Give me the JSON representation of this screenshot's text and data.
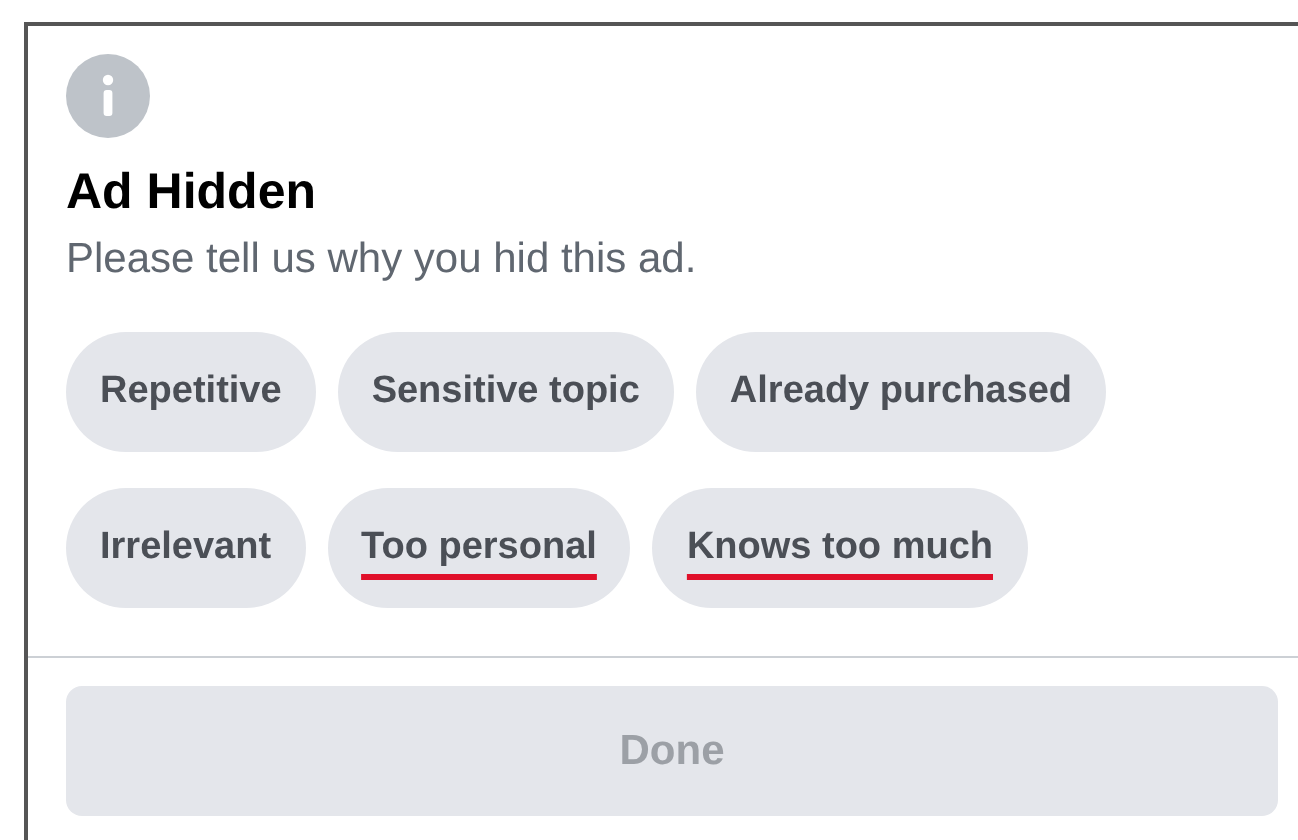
{
  "dialog": {
    "title": "Ad Hidden",
    "message": "Please tell us why you hid this ad.",
    "reasons": [
      {
        "label": "Repetitive",
        "underlined": false
      },
      {
        "label": "Sensitive topic",
        "underlined": false
      },
      {
        "label": "Already purchased",
        "underlined": false
      },
      {
        "label": "Irrelevant",
        "underlined": false
      },
      {
        "label": "Too personal",
        "underlined": true
      },
      {
        "label": "Knows too much",
        "underlined": true
      }
    ],
    "done_button": {
      "label": "Done",
      "disabled": true
    }
  }
}
